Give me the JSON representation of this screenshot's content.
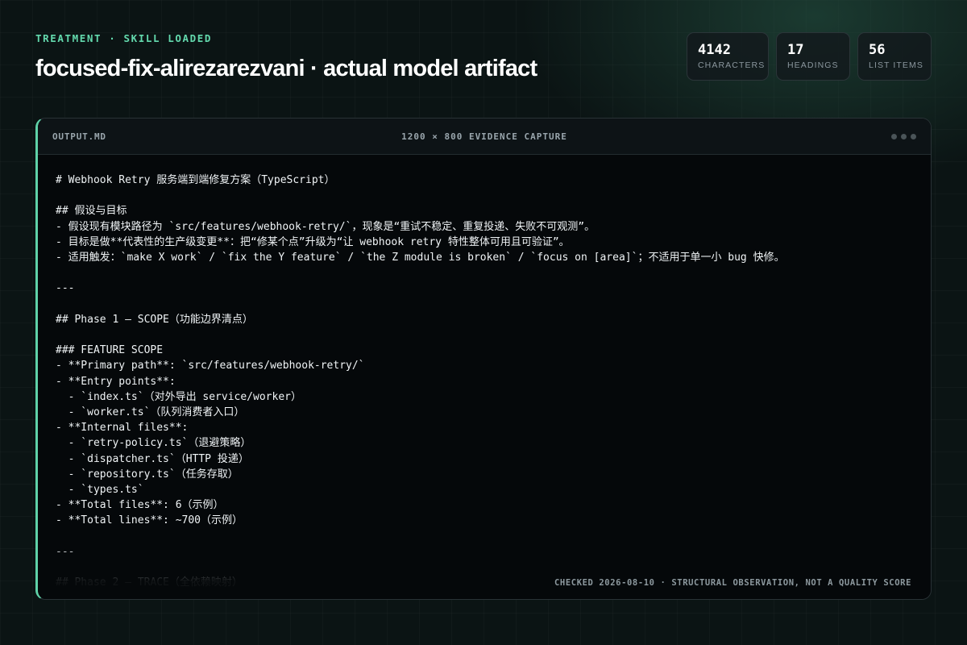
{
  "header": {
    "eyebrow": "TREATMENT · SKILL LOADED",
    "title": "focused-fix-alirezarezvani · actual model artifact"
  },
  "stats": [
    {
      "value": "4142",
      "label": "CHARACTERS"
    },
    {
      "value": "17",
      "label": "HEADINGS"
    },
    {
      "value": "56",
      "label": "LIST ITEMS"
    }
  ],
  "panel": {
    "file_name": "OUTPUT.MD",
    "capture_label": "1200 × 800 EVIDENCE CAPTURE",
    "content": "# Webhook Retry 服务端到端修复方案（TypeScript）\n\n## 假设与目标\n- 假设现有模块路径为 `src/features/webhook-retry/`，现象是“重试不稳定、重复投递、失败不可观测”。\n- 目标是做**代表性的生产级变更**：把“修某个点”升级为“让 webhook retry 特性整体可用且可验证”。\n- 适用触发：`make X work` / `fix the Y feature` / `the Z module is broken` / `focus on [area]`；不适用于单一小 bug 快修。\n\n---\n\n## Phase 1 — SCOPE（功能边界清点）\n\n### FEATURE SCOPE\n- **Primary path**: `src/features/webhook-retry/`\n- **Entry points**:\n  - `index.ts`（对外导出 service/worker）\n  - `worker.ts`（队列消费者入口）\n- **Internal files**:\n  - `retry-policy.ts`（退避策略）\n  - `dispatcher.ts`（HTTP 投递）\n  - `repository.ts`（任务存取）\n  - `types.ts`\n- **Total files**: 6（示例）\n- **Total lines**: ~700（示例）\n\n---\n\n## Phase 2 — TRACE（全依赖映射）",
    "footnote": "CHECKED 2026-08-10 · STRUCTURAL OBSERVATION, NOT A QUALITY SCORE"
  }
}
